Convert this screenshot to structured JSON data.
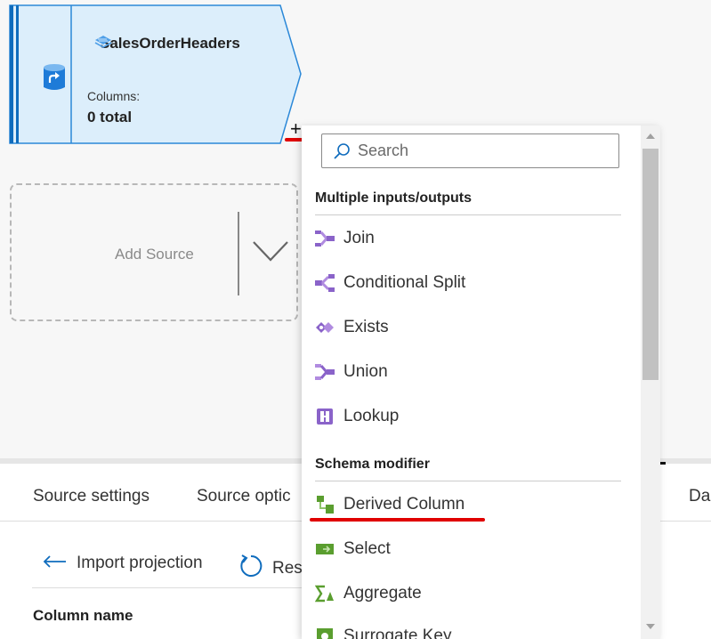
{
  "node": {
    "title": "SalesOrderHeaders",
    "columns_label": "Columns:",
    "columns_value": "0 total",
    "plus_label": "+"
  },
  "add_source": {
    "label": "Add Source"
  },
  "tabs": [
    {
      "label": "Source settings"
    },
    {
      "label": "Source optic"
    },
    {
      "label": "Da"
    }
  ],
  "toolbar": {
    "import_label": "Import projection",
    "reset_label": "Res"
  },
  "table": {
    "column_header": "Column name"
  },
  "menu": {
    "search_placeholder": "Search",
    "sections": [
      {
        "title": "Multiple inputs/outputs",
        "items": [
          {
            "label": "Join",
            "icon": "join-icon"
          },
          {
            "label": "Conditional Split",
            "icon": "conditional-split-icon"
          },
          {
            "label": "Exists",
            "icon": "exists-icon"
          },
          {
            "label": "Union",
            "icon": "union-icon"
          },
          {
            "label": "Lookup",
            "icon": "lookup-icon"
          }
        ]
      },
      {
        "title": "Schema modifier",
        "items": [
          {
            "label": "Derived Column",
            "icon": "derived-column-icon"
          },
          {
            "label": "Select",
            "icon": "select-icon"
          },
          {
            "label": "Aggregate",
            "icon": "aggregate-icon"
          },
          {
            "label": "Surrogate Key",
            "icon": "surrogate-key-icon"
          }
        ]
      }
    ]
  },
  "colors": {
    "node_fill": "#dceefb",
    "node_accent": "#0f6cbd",
    "purple_icon": "#8a63c9",
    "green_icon": "#5a9e2f",
    "highlight_underline": "#e00000"
  }
}
